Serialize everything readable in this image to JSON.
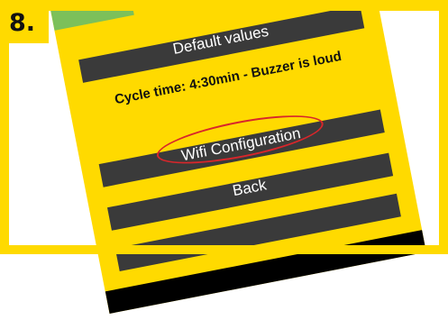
{
  "step": {
    "number": "8."
  },
  "app_screen": {
    "buttons": {
      "default_values": "Default values",
      "wifi_configuration": "Wifi Configuration",
      "back": "Back",
      "extra": ""
    },
    "cycle_info": "Cycle time: 4:30min - Buzzer is loud"
  },
  "colors": {
    "background": "#ffda00",
    "button": "#3a3a3a",
    "highlight": "#d8262b",
    "accent_tab": "#7cc05a"
  }
}
